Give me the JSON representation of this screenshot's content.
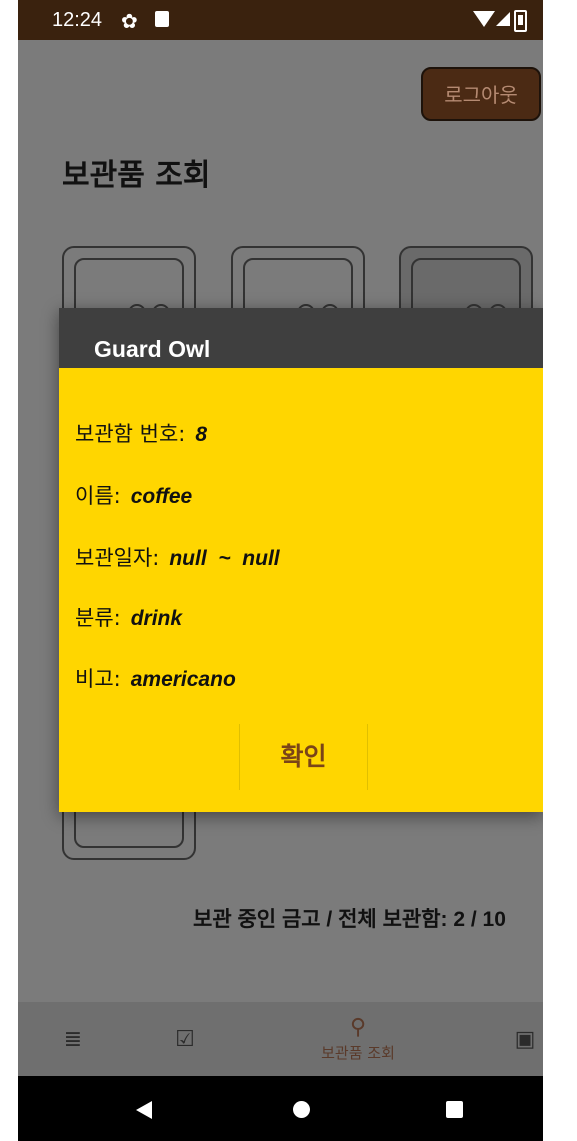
{
  "statusbar": {
    "time": "12:24"
  },
  "header": {
    "logout_label": "로그아웃",
    "page_title": "보관품 조회"
  },
  "summary": {
    "text": "보관 중인 금고 / 전체 보관함: 2 / 10"
  },
  "dialog": {
    "title": "Guard Owl",
    "fields": [
      {
        "label": "보관함 번호:",
        "value": "8"
      },
      {
        "label": "이름:",
        "value": "coffee"
      },
      {
        "label": "보관일자:",
        "value": "null  ~  null"
      },
      {
        "label": "분류:",
        "value": "drink"
      },
      {
        "label": "비고:",
        "value": "americano"
      }
    ],
    "confirm_label": "확인"
  },
  "bottom_nav": {
    "items": [
      {
        "icon": "list-icon",
        "label": ""
      },
      {
        "icon": "clipboard-check-icon",
        "label": ""
      },
      {
        "icon": "search-icon",
        "label": "보관품 조회"
      },
      {
        "icon": "contact-icon",
        "label": ""
      }
    ]
  },
  "colors": {
    "status_bar": "#3a220e",
    "dialog_body": "#ffd600",
    "dialog_header": "#3f3f3f",
    "accent_brown": "#7a4418",
    "logout_bg": "#4b2a14"
  }
}
